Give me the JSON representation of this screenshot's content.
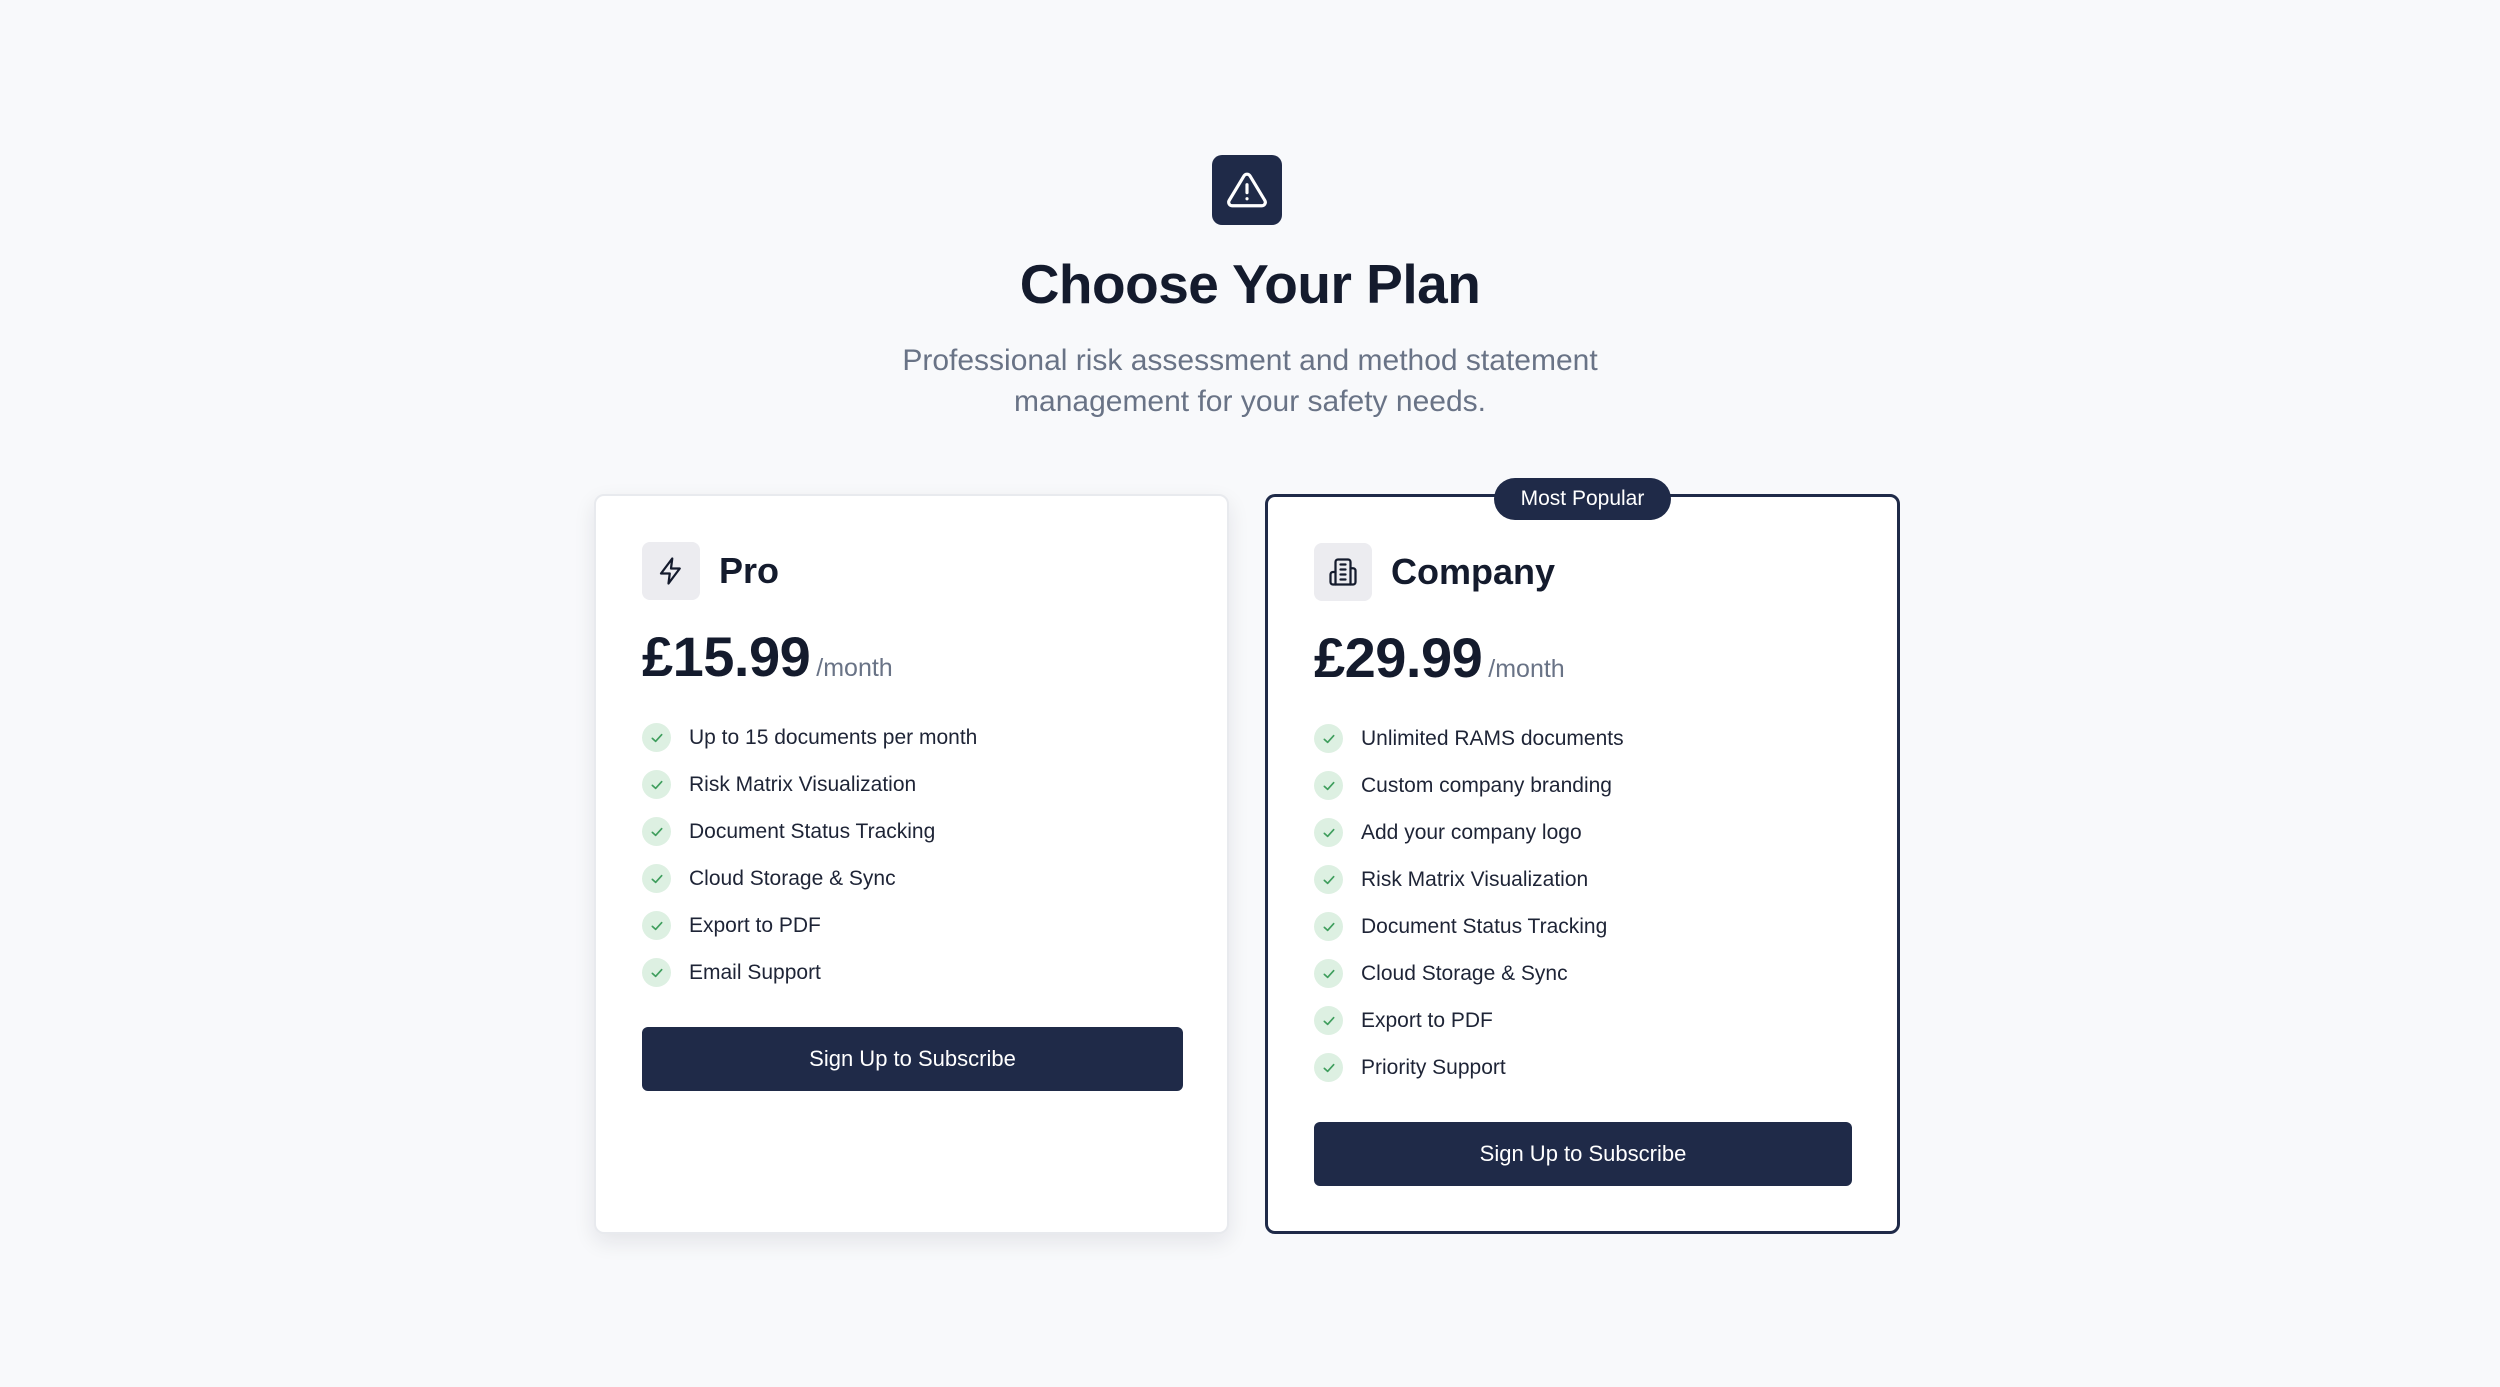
{
  "header": {
    "logo_icon": "warning-triangle-icon",
    "title": "Choose Your Plan",
    "subtitle": "Professional risk assessment and method statement management for your safety needs."
  },
  "plans": [
    {
      "name": "Pro",
      "icon": "lightning-bolt-icon",
      "price": "£15.99",
      "period": "/month",
      "features": [
        "Up to 15 documents per month",
        "Risk Matrix Visualization",
        "Document Status Tracking",
        "Cloud Storage & Sync",
        "Export to PDF",
        "Email Support"
      ],
      "cta_label": "Sign Up to Subscribe"
    },
    {
      "name": "Company",
      "icon": "building-icon",
      "badge": "Most Popular",
      "price": "£29.99",
      "period": "/month",
      "features": [
        "Unlimited RAMS documents",
        "Custom company branding",
        "Add your company logo",
        "Risk Matrix Visualization",
        "Document Status Tracking",
        "Cloud Storage & Sync",
        "Export to PDF",
        "Priority Support"
      ],
      "cta_label": "Sign Up to Subscribe"
    }
  ],
  "colors": {
    "brand": "#1f2a48",
    "background": "#f8f9fb",
    "check_bg": "#ddf0e2",
    "check_mark": "#3f9e5d",
    "muted_text": "#697386"
  }
}
